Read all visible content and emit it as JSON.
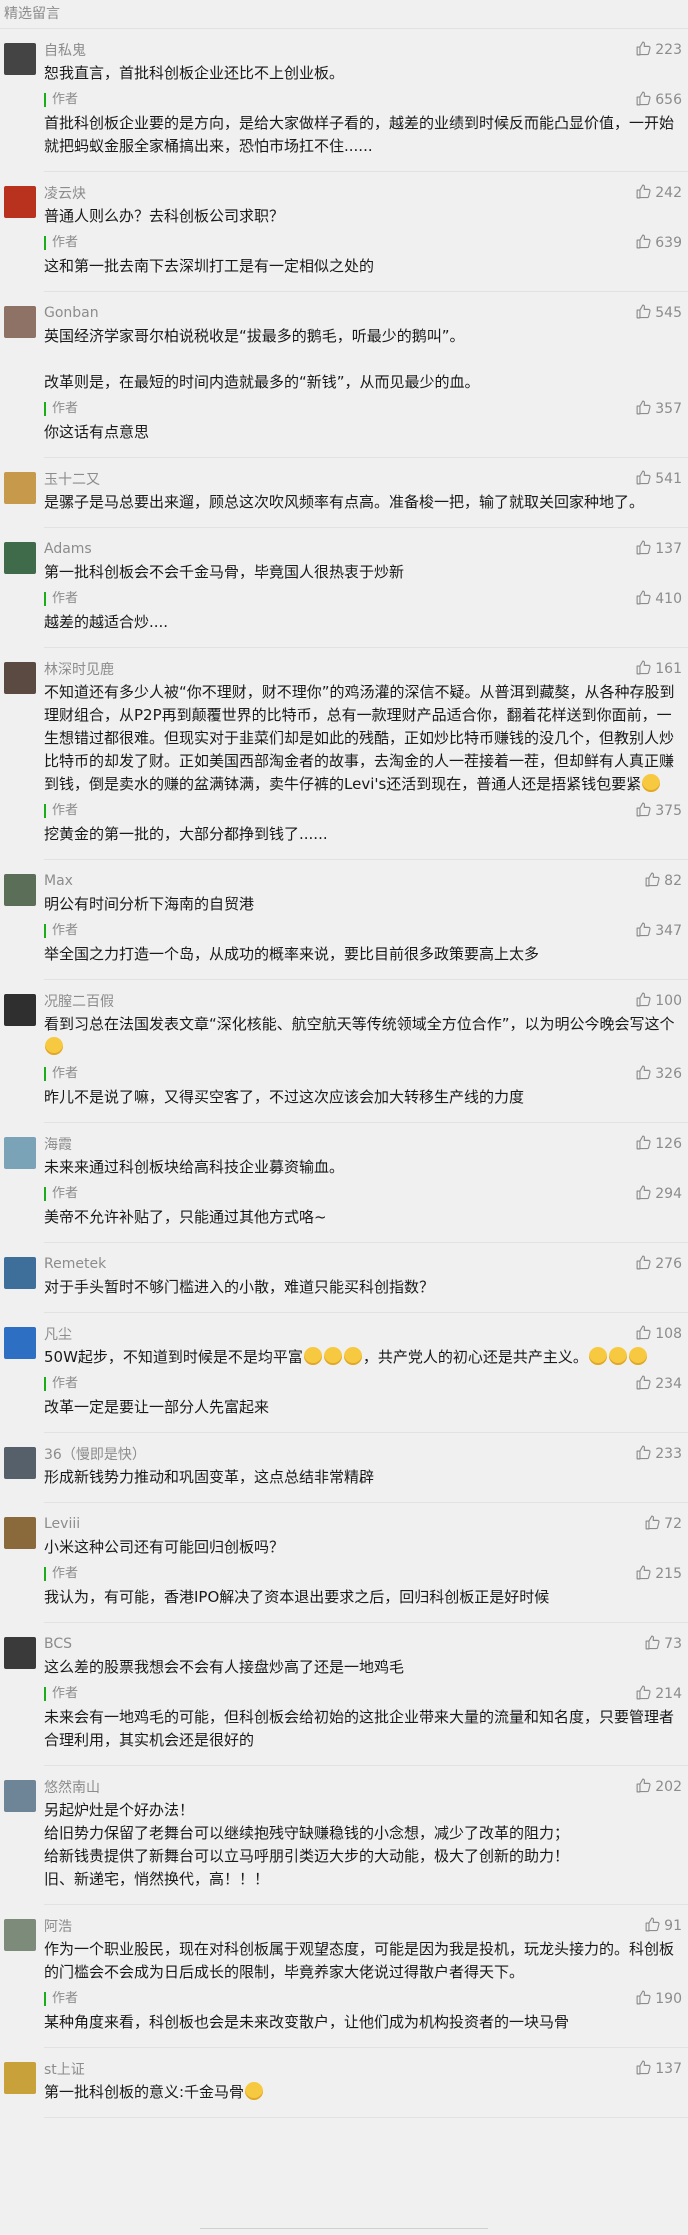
{
  "header": {
    "title": "精选留言"
  },
  "author_label": "作者",
  "colors": {
    "accent": "#1aad19",
    "muted": "#8c8c8c",
    "bg": "#f0f0f0"
  },
  "icons": {
    "like": "thumbs-up-outline-icon",
    "emoji": "smiley-emoji-icon"
  },
  "comments": [
    {
      "nick": "自私鬼",
      "likes": "223",
      "avatar_color": "#444444",
      "text": "恕我直言，首批科创板企业还比不上创业板。",
      "reply": {
        "text": "首批科创板企业要的是方向，是给大家做样子看的，越差的业绩到时候反而能凸显价值，一开始就把蚂蚁金服全家桶搞出来，恐怕市场扛不住......",
        "likes": "656"
      }
    },
    {
      "nick": "凌云炔",
      "likes": "242",
      "avatar_color": "#b8321e",
      "text": "普通人则么办？去科创板公司求职？",
      "reply": {
        "text": "这和第一批去南下去深圳打工是有一定相似之处的",
        "likes": "639"
      }
    },
    {
      "nick": "Gonban",
      "likes": "545",
      "avatar_color": "#8e7265",
      "text": "英国经济学家哥尔柏说税收是“拔最多的鹅毛，听最少的鹅叫”。\n\n改革则是，在最短的时间内造就最多的“新钱”，从而见最少的血。",
      "reply": {
        "text": "你这话有点意思",
        "likes": "357"
      }
    },
    {
      "nick": "玉十二又",
      "likes": "541",
      "avatar_color": "#c69a4a",
      "text": "是骡子是马总要出来遛，顾总这次吹风频率有点高。准备梭一把，输了就取关回家种地了。",
      "reply": null
    },
    {
      "nick": "Adams",
      "likes": "137",
      "avatar_color": "#3f6b4a",
      "text": "第一批科创板会不会千金马骨，毕竟国人很热衷于炒新",
      "reply": {
        "text": "越差的越适合炒....",
        "likes": "410"
      }
    },
    {
      "nick": "林深时见鹿",
      "likes": "161",
      "avatar_color": "#5a4a42",
      "text": "不知道还有多少人被“你不理财，财不理你”的鸡汤灌的深信不疑。从普洱到藏獒，从各种存股到理财组合，从P2P再到颠覆世界的比特币，总有一款理财产品适合你，翻着花样送到你面前，一生想错过都很难。但现实对于韭菜们却是如此的残酷，正如炒比特币赚钱的没几个，但教别人炒比特币的却发了财。正如美国西部淘金者的故事，去淘金的人一茬接着一茬，但却鲜有人真正赚到钱，倒是卖水的赚的盆满钵满，卖牛仔裤的Levi's还活到现在，普通人还是捂紧钱包要紧",
      "emoji_after_text": 1,
      "reply": {
        "text": "挖黄金的第一批的，大部分都挣到钱了......",
        "likes": "375"
      }
    },
    {
      "nick": "Max",
      "likes": "82",
      "avatar_color": "#5b6e58",
      "text": "明公有时间分析下海南的自贸港",
      "reply": {
        "text": "举全国之力打造一个岛，从成功的概率来说，要比目前很多政策要高上太多",
        "likes": "347"
      }
    },
    {
      "nick": "况膣二百假",
      "likes": "100",
      "avatar_color": "#2f2f2f",
      "text": "看到习总在法国发表文章“深化核能、航空航天等传统领域全方位合作”，以为明公今晚会写这个",
      "emoji_after_text": 1,
      "reply": {
        "text": "昨儿不是说了嘛，又得买空客了，不过这次应该会加大转移生产线的力度",
        "likes": "326"
      }
    },
    {
      "nick": "海霞",
      "likes": "126",
      "avatar_color": "#7ba3b8",
      "text": "未来来通过科创板块给高科技企业募资输血。",
      "reply": {
        "text": "美帝不允许补贴了，只能通过其他方式咯~",
        "likes": "294"
      }
    },
    {
      "nick": "Remetek",
      "likes": "276",
      "avatar_color": "#3e6e9a",
      "text": "对于手头暂时不够门槛进入的小散，难道只能买科创指数？",
      "reply": null
    },
    {
      "nick": "凡尘",
      "likes": "108",
      "avatar_color": "#2d6fc2",
      "text": "50W起步，不知道到时候是不是均平富",
      "emoji_after_text": 3,
      "text2": "，共产党人的初心还是共产主义。",
      "emoji_after_text2": 3,
      "reply": {
        "text": "改革一定是要让一部分人先富起来",
        "likes": "234"
      }
    },
    {
      "nick": "36（慢即是快）",
      "likes": "233",
      "avatar_color": "#55606a",
      "text": "形成新钱势力推动和巩固变革，这点总结非常精辟",
      "reply": null
    },
    {
      "nick": "Leviii",
      "likes": "72",
      "avatar_color": "#8a6a3a",
      "text": "小米这种公司还有可能回归创板吗？",
      "reply": {
        "text": "我认为，有可能，香港IPO解决了资本退出要求之后，回归科创板正是好时候",
        "likes": "215"
      }
    },
    {
      "nick": "BCS",
      "likes": "73",
      "avatar_color": "#3a3a3a",
      "text": "这么差的股票我想会不会有人接盘炒高了还是一地鸡毛",
      "reply": {
        "text": "未来会有一地鸡毛的可能，但科创板会给初始的这批企业带来大量的流量和知名度，只要管理者合理利用，其实机会还是很好的",
        "likes": "214"
      }
    },
    {
      "nick": "悠然南山",
      "likes": "202",
      "avatar_color": "#6d8596",
      "text": "另起炉灶是个好办法！\n给旧势力保留了老舞台可以继续抱残守缺赚稳钱的小念想，减少了改革的阻力；\n给新钱贵提供了新舞台可以立马呼朋引类迈大步的大动能，极大了创新的助力！\n旧、新递宅，悄然换代，高！！！",
      "reply": null
    },
    {
      "nick": "阿浩",
      "likes": "91",
      "avatar_color": "#7d8c7a",
      "text": "作为一个职业股民，现在对科创板属于观望态度，可能是因为我是投机，玩龙头接力的。科创板的门槛会不会成为日后成长的限制，毕竟养家大佬说过得散户者得天下。",
      "reply": {
        "text": "某种角度来看，科创板也会是未来改变散户，让他们成为机构投资者的一块马骨",
        "likes": "190"
      }
    },
    {
      "nick": "st上证",
      "likes": "137",
      "avatar_color": "#c8a13a",
      "text": "第一批科创板的意义:千金马骨",
      "emoji_after_text": 1,
      "reply": null
    }
  ]
}
